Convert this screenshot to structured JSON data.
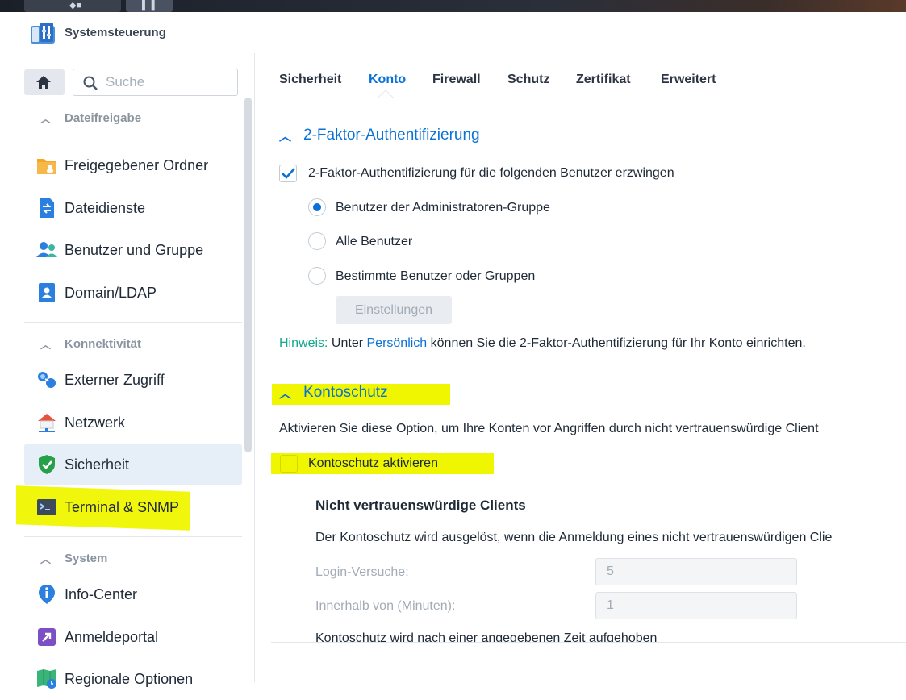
{
  "app": {
    "title": "Systemsteuerung"
  },
  "search": {
    "placeholder": "Suche"
  },
  "sidebar": {
    "groups": [
      {
        "label": "Dateifreigabe"
      },
      {
        "label": "Konnektivität"
      },
      {
        "label": "System"
      }
    ],
    "items": [
      {
        "label": "Freigegebener Ordner",
        "icon": "folder-share-icon"
      },
      {
        "label": "Dateidienste",
        "icon": "file-services-icon"
      },
      {
        "label": "Benutzer und Gruppe",
        "icon": "users-icon"
      },
      {
        "label": "Domain/LDAP",
        "icon": "domain-icon"
      },
      {
        "label": "Externer Zugriff",
        "icon": "external-access-icon"
      },
      {
        "label": "Netzwerk",
        "icon": "network-icon"
      },
      {
        "label": "Sicherheit",
        "icon": "shield-check-icon",
        "active": true
      },
      {
        "label": "Terminal & SNMP",
        "icon": "terminal-icon"
      },
      {
        "label": "Info-Center",
        "icon": "info-icon"
      },
      {
        "label": "Anmeldeportal",
        "icon": "login-portal-icon"
      },
      {
        "label": "Regionale Optionen",
        "icon": "region-icon"
      }
    ]
  },
  "tabs": [
    {
      "label": "Sicherheit"
    },
    {
      "label": "Konto",
      "active": true
    },
    {
      "label": "Firewall"
    },
    {
      "label": "Schutz"
    },
    {
      "label": "Zertifikat"
    },
    {
      "label": "Erweitert"
    }
  ],
  "twofa": {
    "title": "2-Faktor-Authentifizierung",
    "enforce_label": "2-Faktor-Authentifizierung für die folgenden Benutzer erzwingen",
    "enforce_checked": true,
    "options": [
      {
        "label": "Benutzer der Administratoren-Gruppe",
        "selected": true
      },
      {
        "label": "Alle Benutzer",
        "selected": false
      },
      {
        "label": "Bestimmte Benutzer oder Gruppen",
        "selected": false
      }
    ],
    "settings_button": "Einstellungen",
    "hint_key": "Hinweis:",
    "hint_before": "Unter",
    "hint_link": "Persönlich",
    "hint_after": "können Sie die 2-Faktor-Authentifizierung für Ihr Konto einrichten."
  },
  "kontoschutz": {
    "title": "Kontoschutz",
    "description": "Aktivieren Sie diese Option, um Ihre Konten vor Angriffen durch nicht vertrauenswürdige Client",
    "enable_label": "Kontoschutz aktivieren",
    "enable_checked": false,
    "untrusted_title": "Nicht vertrauenswürdige Clients",
    "untrusted_desc": "Der Kontoschutz wird ausgelöst, wenn die Anmeldung eines nicht vertrauenswürdigen Clie",
    "login_attempts_label": "Login-Versuche:",
    "login_attempts_value": "5",
    "within_label": "Innerhalb von (Minuten):",
    "within_value": "1",
    "cut_text": "Kontoschutz wird nach einer angegebenen Zeit aufgehoben"
  },
  "colors": {
    "accent": "#0a72d6",
    "highlight": "#f0f500",
    "hint": "#11a98d"
  }
}
